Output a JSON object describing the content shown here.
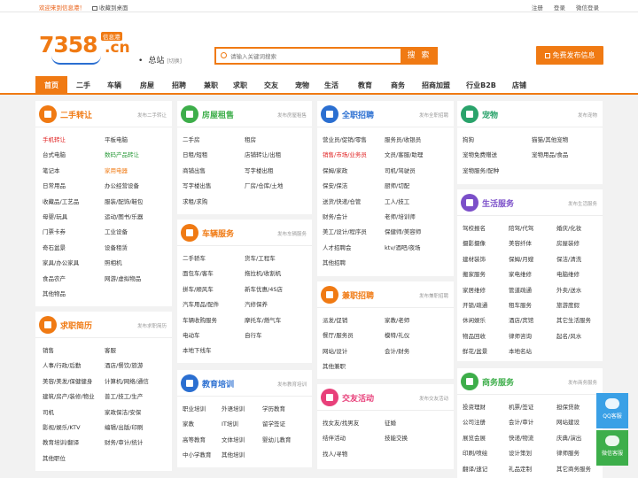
{
  "topbar": {
    "welcome": "欢迎来到信息港！",
    "favorite": "收藏到桌面",
    "register": "注册",
    "login": "登录",
    "wechat_login": "微信登录"
  },
  "header": {
    "logo_number": "7358",
    "logo_suffix": ".cn",
    "logo_tag": "信息港",
    "station": "总站",
    "station_switch": "[切换]",
    "search_placeholder": "请输入关键词搜索",
    "search_button": "搜 索",
    "publish_button": "免费发布信息"
  },
  "colors": {
    "accent": "#f07a13"
  },
  "nav": [
    "首页",
    "二手",
    "车辆",
    "房屋",
    "招聘",
    "兼职",
    "求职",
    "交友",
    "宠物",
    "生活",
    "教育",
    "商务",
    "招商加盟",
    "行业B2B",
    "店铺"
  ],
  "panels": {
    "ershou": {
      "title": "二手转让",
      "more": "发布二手转让",
      "color": "#f07a13",
      "icon": "tag-icon",
      "rows": [
        [
          "手机转让",
          "平板电脑"
        ],
        [
          "台式电脑",
          "数码产品转让"
        ],
        [
          "笔记本",
          "家用电器"
        ],
        [
          "日常用品",
          "办公经营设备"
        ],
        [
          "收藏品/工艺品",
          "服装/配饰/鞋包"
        ],
        [
          "母婴/玩具",
          "运动/图书/乐器"
        ],
        [
          "门票卡券",
          "工业设备"
        ],
        [
          "奇石盆景",
          "设备租赁"
        ],
        [
          "家具/办公家具",
          "照相机"
        ],
        [
          "食品农产",
          "网游/虚拟物品"
        ],
        [
          "其他物品",
          ""
        ]
      ]
    },
    "fangwu": {
      "title": "房屋租售",
      "more": "发布房屋租售",
      "color": "#3dae4a",
      "icon": "house-icon",
      "rows": [
        [
          "二手房",
          "租房"
        ],
        [
          "日租/短租",
          "店铺转让/出租"
        ],
        [
          "商铺出售",
          "写字楼出租"
        ],
        [
          "写字楼出售",
          "厂房/仓库/土地"
        ],
        [
          "求租/求购",
          ""
        ]
      ]
    },
    "quanzhi": {
      "title": "全职招聘",
      "more": "发布全职招聘",
      "color": "#2b6fd1",
      "icon": "magnifier-icon",
      "rows": [
        [
          "营业员/促销/零售",
          "服务员/收银员"
        ],
        [
          "销售/市场/业务员",
          "文员/客服/助理"
        ],
        [
          "保姆/家政",
          "司机/驾驶员"
        ],
        [
          "保安/保洁",
          "厨师/切配"
        ],
        [
          "送货/快递/仓管",
          "工人/技工"
        ],
        [
          "财务/会计",
          "老师/培训师"
        ],
        [
          "美工/设计/程序员",
          "保健师/美容师"
        ],
        [
          "人才招聘会",
          "ktv/酒吧/夜场"
        ],
        [
          "其他招聘",
          ""
        ]
      ]
    },
    "chongwu": {
      "title": "宠物",
      "more": "发布宠物",
      "color": "#2aa36b",
      "icon": "paw-icon",
      "rows": [
        [
          "狗狗",
          "猫猫/其他宠物"
        ],
        [
          "宠物免费赠送",
          "宠物用品/食品"
        ],
        [
          "宠物服务/配种",
          ""
        ]
      ]
    },
    "shenghuo": {
      "title": "生活服务",
      "more": "发布生活服务",
      "color": "#7b4fc9",
      "icon": "umbrella-icon",
      "rows": [
        [
          "驾校报名",
          "陪驾/代驾",
          "婚庆/化妆"
        ],
        [
          "摄影摄像",
          "美容纤体",
          "房屋装修"
        ],
        [
          "建材装饰",
          "保姆/月嫂",
          "保洁/清洗"
        ],
        [
          "搬家服务",
          "家电维修",
          "电脑维修"
        ],
        [
          "家居维修",
          "管道疏通",
          "外卖/送水"
        ],
        [
          "开锁/疏通",
          "租车服务",
          "旅游度假"
        ],
        [
          "休闲娱乐",
          "酒店/宾馆",
          "其它生活服务"
        ],
        [
          "物品回收",
          "律师咨询",
          "起名/风水"
        ],
        [
          "鲜花/盆景",
          "本地名站",
          ""
        ]
      ]
    },
    "cheliang": {
      "title": "车辆服务",
      "more": "发布车辆服务",
      "color": "#f07a13",
      "icon": "car-icon",
      "rows": [
        [
          "二手轿车",
          "货车/工程车"
        ],
        [
          "面包车/客车",
          "拖拉机/收割机"
        ],
        [
          "拼车/顺风车",
          "新车优惠/4S店"
        ],
        [
          "汽车用品/配件",
          "汽修保养"
        ],
        [
          "车辆收购服务",
          "摩托车/燃气车"
        ],
        [
          "电动车",
          "自行车"
        ],
        [
          "本地下线车",
          ""
        ]
      ]
    },
    "jianzhi": {
      "title": "兼职招聘",
      "more": "发布兼职招聘",
      "color": "#f07a13",
      "icon": "person-icon",
      "rows": [
        [
          "派发/促销",
          "家教/老师"
        ],
        [
          "餐厅/服务员",
          "模特/礼仪"
        ],
        [
          "网站/设计",
          "会计/财务"
        ],
        [
          "其他兼职",
          ""
        ]
      ]
    },
    "qiuzhi": {
      "title": "求职简历",
      "more": "发布求职简历",
      "color": "#f07a13",
      "icon": "resume-icon",
      "rows": [
        [
          "销售",
          "客服"
        ],
        [
          "人事/行政/后勤",
          "酒店/餐饮/旅游"
        ],
        [
          "美容/美发/保健健身",
          "计算机/网络/通信"
        ],
        [
          "建筑/房产/装修/物业",
          "普工/技工/生产"
        ],
        [
          "司机",
          "家政保洁/安保"
        ],
        [
          "影视/娱乐/KTV",
          "编辑/出版/印刷"
        ],
        [
          "教育培训/翻译",
          "财务/审计/统计"
        ],
        [
          "其他职位",
          ""
        ]
      ]
    },
    "jiaoyu": {
      "title": "教育培训",
      "more": "发布教育培训",
      "color": "#2b6fd1",
      "icon": "graduation-cap-icon",
      "rows": [
        [
          "职业培训",
          "外语培训",
          "学历教育"
        ],
        [
          "家教",
          "IT培训",
          "留学签证"
        ],
        [
          "高等教育",
          "文体培训",
          "婴幼儿教育"
        ],
        [
          "中小学教育",
          "其他培训",
          ""
        ]
      ]
    },
    "jiaoyou": {
      "title": "交友活动",
      "more": "发布交友活动",
      "color": "#e8407a",
      "icon": "heart-icon",
      "rows": [
        [
          "找女友/找男友",
          "征婚"
        ],
        [
          "结伴活动",
          "技能交换"
        ],
        [
          "找人/寻物",
          ""
        ]
      ]
    },
    "shangwu": {
      "title": "商务服务",
      "more": "发布商务服务",
      "color": "#3dae4a",
      "icon": "people-icon",
      "rows": [
        [
          "投资理财",
          "机票/签证",
          "担保贷款"
        ],
        [
          "公司注册",
          "会计/审计",
          "网站建设"
        ],
        [
          "展览会展",
          "快递/物流",
          "庆典/演出"
        ],
        [
          "印刷/喷绘",
          "设计策划",
          "律师服务"
        ],
        [
          "翻译/速记",
          "礼品定制",
          "其它商务服务"
        ]
      ]
    }
  },
  "float_buttons": {
    "qq": "QQ客服",
    "wechat": "微信客服"
  }
}
